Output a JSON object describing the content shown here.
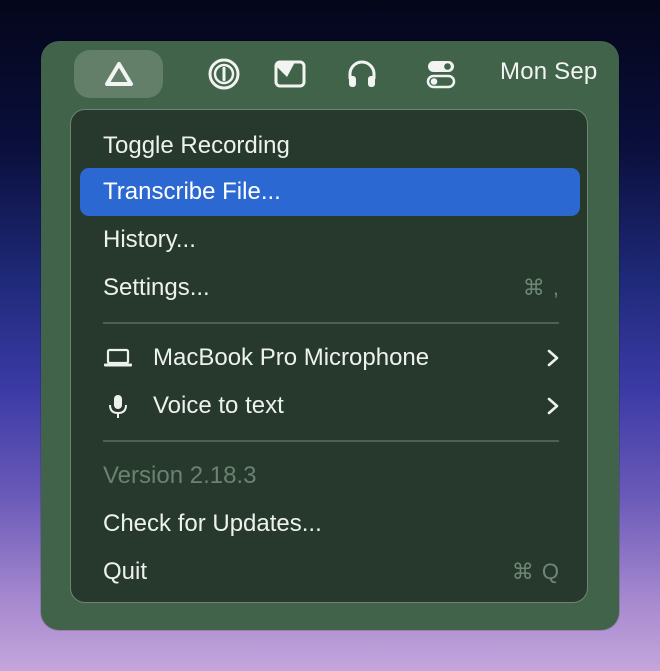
{
  "menubar": {
    "icons": [
      {
        "name": "app-triangle-icon",
        "active": true
      },
      {
        "name": "password-manager-icon",
        "active": false
      },
      {
        "name": "window-manager-icon",
        "active": false
      },
      {
        "name": "headphones-icon",
        "active": false
      },
      {
        "name": "control-center-icon",
        "active": false
      }
    ],
    "clock_text": "Mon Sep "
  },
  "menu": {
    "items": [
      {
        "label": "Toggle Recording"
      },
      {
        "label": "Transcribe File...",
        "highlighted": true
      },
      {
        "label": "History..."
      },
      {
        "label": "Settings...",
        "shortcut": "⌘ ,"
      },
      {
        "label": "MacBook Pro Microphone",
        "icon": "laptop-icon",
        "submenu": true
      },
      {
        "label": "Voice to text",
        "icon": "microphone-icon",
        "submenu": true
      },
      {
        "label": "Version 2.18.3",
        "disabled": true
      },
      {
        "label": "Check for Updates..."
      },
      {
        "label": "Quit",
        "shortcut": "⌘ Q"
      }
    ]
  },
  "colors": {
    "window": "#416349",
    "menu_background": "#26392c",
    "highlight": "#2c68d2"
  }
}
